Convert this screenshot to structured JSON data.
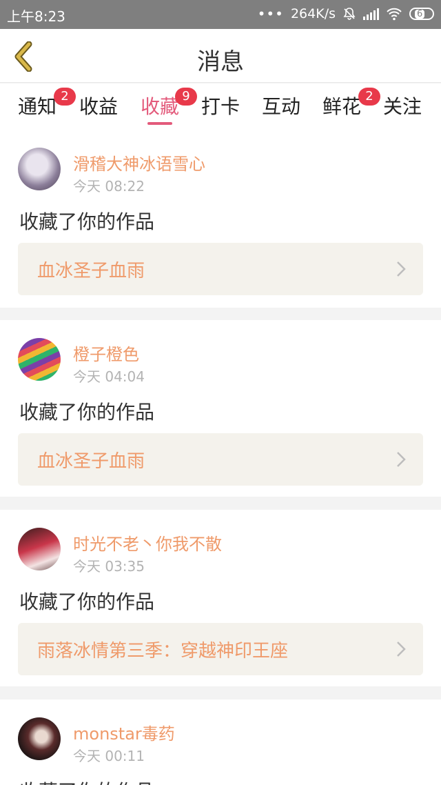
{
  "status_bar": {
    "time": "上午8:23",
    "net_speed": "264K/s",
    "battery_level": "6",
    "icons": [
      "dots-icon",
      "bell-off-icon",
      "signal-icon",
      "wifi-icon",
      "battery-icon"
    ]
  },
  "header": {
    "title": "消息",
    "back_icon": "chevron-left-icon",
    "accent_color": "#c8a43a"
  },
  "tabs": [
    {
      "label": "通知",
      "badge": "2",
      "active": false
    },
    {
      "label": "收益",
      "badge": "",
      "active": false
    },
    {
      "label": "收藏",
      "badge": "9",
      "active": true
    },
    {
      "label": "打卡",
      "badge": "",
      "active": false
    },
    {
      "label": "互动",
      "badge": "",
      "active": false
    },
    {
      "label": "鲜花",
      "badge": "2",
      "active": false
    },
    {
      "label": "关注",
      "badge": "",
      "active": false
    }
  ],
  "colors": {
    "active_tab": "#e35a7b",
    "badge": "#e8394a",
    "username": "#ef9a6a",
    "work_title": "#ef9a6a",
    "work_bg": "#f4f2ec"
  },
  "messages": [
    {
      "username": "滑稽大神冰语雪心",
      "time": "今天 08:22",
      "action": "收藏了你的作品",
      "work_title": "血冰圣子血雨"
    },
    {
      "username": "橙子橙色",
      "time": "今天 04:04",
      "action": "收藏了你的作品",
      "work_title": "血冰圣子血雨"
    },
    {
      "username": "时光不老丶你我不散",
      "time": "今天 03:35",
      "action": "收藏了你的作品",
      "work_title": "雨落冰情第三季：穿越神印王座"
    },
    {
      "username": "monstar毒药",
      "time": "今天 00:11",
      "action": "收藏了你的作品",
      "work_title": ""
    }
  ]
}
